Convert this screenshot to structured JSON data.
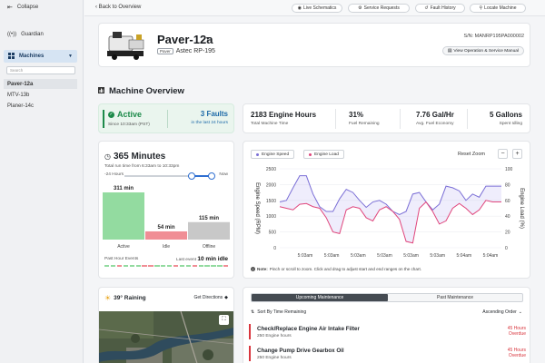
{
  "sidebar": {
    "collapse_label": "Collapse",
    "guardian_label": "Guardian",
    "machines_label": "Machines",
    "search_placeholder": "Search",
    "items": [
      {
        "label": "Paver-12a",
        "active": true
      },
      {
        "label": "MTV-13b",
        "active": false
      },
      {
        "label": "Planer-14c",
        "active": false
      }
    ]
  },
  "topbar": {
    "back_label": "Back to Overview",
    "buttons": [
      {
        "label": "Live Schematics",
        "icon": "broadcast-icon"
      },
      {
        "label": "Service Requests",
        "icon": "gear-icon"
      },
      {
        "label": "Fault History",
        "icon": "history-icon"
      },
      {
        "label": "Locate Machine",
        "icon": "pin-icon"
      }
    ]
  },
  "machine": {
    "name": "Paver-12a",
    "type_tag": "Paver",
    "model": "Astec RP-195",
    "serial": "S/N: MANRP195PA000002",
    "manual_button": "View Operation & Service Manual"
  },
  "overview": {
    "heading": "Machine Overview",
    "status": {
      "value": "Active",
      "sub": "Since 10:33am (PST)"
    },
    "faults": {
      "value": "3 Faults",
      "sub": "in the last 24 hours"
    },
    "stats": [
      {
        "value": "2183 Engine Hours",
        "label": "Total Machine Time"
      },
      {
        "value": "31%",
        "label": "Fuel Remaining"
      },
      {
        "value": "7.76 Gal/Hr",
        "label": "Avg. Fuel Economy"
      },
      {
        "value": "5 Gallons",
        "label": "Spent Idling"
      }
    ]
  },
  "runtime": {
    "value": "365 Minutes",
    "sub": "Total run time from 6:33am to 10:33pm",
    "range_start": "-24 Hours",
    "range_end": "Now",
    "slider_from": 0.77,
    "slider_to": 1.0,
    "bars": [
      {
        "label": "Active",
        "value": "311 min",
        "minutes": 311,
        "color": "#93dba0"
      },
      {
        "label": "Idle",
        "value": "54 min",
        "minutes": 54,
        "color": "#f08e95"
      },
      {
        "label": "Offline",
        "value": "115 min",
        "minutes": 115,
        "color": "#c8c8c8"
      }
    ],
    "events_label": "Past Hour Events",
    "last_event_prefix": "Last event",
    "last_event_value": "10 min idle"
  },
  "chart": {
    "legend": [
      {
        "label": "Engine Speed",
        "color": "#7b6fd6"
      },
      {
        "label": "Engine Load",
        "color": "#e0467c"
      }
    ],
    "reset_zoom": "Reset Zoom",
    "zoom_out": "−",
    "zoom_in": "+",
    "note_prefix": "Note:",
    "note": "Pinch or scroll to zoom. Click and drag to adjust start and end ranges on the chart."
  },
  "chart_data": {
    "type": "line",
    "ylabel": "Engine Speed (RPM)",
    "y2label": "Engine Load (%)",
    "ylim": [
      0,
      2500
    ],
    "y2lim": [
      0,
      100
    ],
    "yticks": [
      0,
      500,
      1000,
      1500,
      2000,
      2500
    ],
    "y2ticks": [
      0,
      20,
      40,
      60,
      80,
      100
    ],
    "xticks": [
      "5:03am",
      "5:03am",
      "5:03am",
      "5:03am",
      "5:03am",
      "5:03am",
      "5:04am",
      "5:04am"
    ],
    "x": [
      0,
      0.03,
      0.06,
      0.09,
      0.12,
      0.15,
      0.18,
      0.21,
      0.24,
      0.27,
      0.3,
      0.33,
      0.36,
      0.39,
      0.42,
      0.45,
      0.48,
      0.51,
      0.54,
      0.57,
      0.6,
      0.63,
      0.66,
      0.69,
      0.72,
      0.75,
      0.78,
      0.81,
      0.84,
      0.87,
      0.9,
      0.93,
      0.96,
      1.0
    ],
    "series": [
      {
        "name": "Engine Speed",
        "axis": "left",
        "color": "#7b6fd6",
        "values": [
          1450,
          1500,
          1900,
          2280,
          2280,
          1700,
          1300,
          1150,
          1150,
          1550,
          1850,
          1750,
          1500,
          1280,
          1450,
          1500,
          1380,
          1150,
          1050,
          1150,
          1700,
          1750,
          1450,
          1200,
          1380,
          1950,
          1900,
          1800,
          1500,
          1700,
          1600,
          1950,
          1950,
          1950
        ]
      },
      {
        "name": "Engine Load",
        "axis": "right",
        "color": "#e0467c",
        "values": [
          52,
          50,
          48,
          55,
          56,
          52,
          50,
          38,
          20,
          18,
          48,
          52,
          50,
          38,
          34,
          48,
          52,
          46,
          36,
          8,
          6,
          50,
          58,
          46,
          30,
          34,
          50,
          56,
          50,
          42,
          48,
          60,
          58,
          58
        ]
      }
    ]
  },
  "weather": {
    "text": "39° Raining",
    "directions": "Get Directions"
  },
  "maintenance": {
    "tabs": [
      {
        "label": "Upcoming Maintenance",
        "active": true
      },
      {
        "label": "Past Maintenance",
        "active": false
      }
    ],
    "sort_label": "Sort By Time Remaining",
    "order_label": "Ascending Order",
    "items": [
      {
        "title": "Check/Replace Engine Air Intake Filter",
        "sub": "250 Engine hours",
        "status": "45 Hours",
        "status2": "Overdue"
      },
      {
        "title": "Change Pump Drive Gearbox Oil",
        "sub": "250 Engine hours",
        "status": "45 Hours",
        "status2": "Overdue"
      }
    ]
  },
  "colors": {
    "accent": "#1c3d63",
    "active_green": "#1d8a4a",
    "overdue_red": "#d9363e",
    "slider_blue": "#2f6fd1"
  }
}
